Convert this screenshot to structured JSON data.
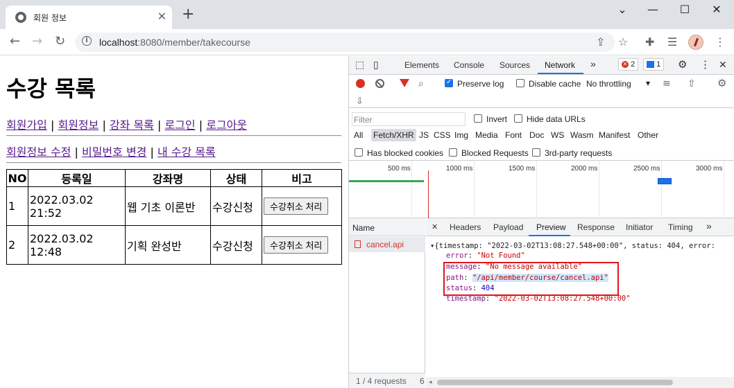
{
  "browser": {
    "tab_title": "회원 정보",
    "url_host": "localhost",
    "url_path": ":8080/member/takecourse",
    "new_tab_symbol": "+",
    "tab_close_symbol": "✕",
    "window_controls": {
      "minimize": "—",
      "maximize": "☐",
      "close": "✕"
    },
    "dropdown_symbol": "⌄",
    "icons": [
      "back-arrow-icon",
      "forward-arrow-icon",
      "reload-icon",
      "site-info-icon",
      "share-icon",
      "bookmark-star-icon",
      "extensions-icon",
      "reading-list-icon",
      "profile-avatar-icon",
      "browser-menu-icon"
    ]
  },
  "page": {
    "heading": "수강 목록",
    "nav1": [
      "회원가입",
      "회원정보",
      "강좌 목록",
      "로그인",
      "로그아웃"
    ],
    "nav2": [
      "회원정보 수정",
      "비밀번호 변경",
      "내 수강 목록"
    ],
    "separator": "|",
    "table": {
      "headers": [
        "NO",
        "등록일",
        "강좌명",
        "상태",
        "비고"
      ],
      "rows": [
        {
          "no": "1",
          "date": "2022.03.02 21:52",
          "course": "웹 기초 이론반",
          "status": "수강신청",
          "action": "수강취소 처리"
        },
        {
          "no": "2",
          "date": "2022.03.02 12:48",
          "course": "기획 완성반",
          "status": "수강신청",
          "action": "수강취소 처리"
        }
      ]
    }
  },
  "devtools": {
    "tabs": [
      "Elements",
      "Console",
      "Sources",
      "Network"
    ],
    "active_tab": "Network",
    "more_tabs": "»",
    "error_count": "2",
    "message_count": "1",
    "preserve_log": "Preserve log",
    "disable_cache": "Disable cache",
    "throttling": "No throttling",
    "filter_placeholder": "Filter",
    "invert": "Invert",
    "hide_data_urls": "Hide data URLs",
    "type_filters": [
      "All",
      "Fetch/XHR",
      "JS",
      "CSS",
      "Img",
      "Media",
      "Font",
      "Doc",
      "WS",
      "Wasm",
      "Manifest",
      "Other"
    ],
    "active_type": "Fetch/XHR",
    "has_blocked_cookies": "Has blocked cookies",
    "blocked_requests": "Blocked Requests",
    "third_party": "3rd-party requests",
    "timeline_ticks": [
      "500 ms",
      "1000 ms",
      "1500 ms",
      "2000 ms",
      "2500 ms",
      "3000 ms"
    ],
    "name_header": "Name",
    "request_name": "cancel.api",
    "status_bar": "1 / 4 requests",
    "status_bar_cut": "6",
    "sub_tabs": [
      "Headers",
      "Payload",
      "Preview",
      "Response",
      "Initiator",
      "Timing"
    ],
    "active_sub_tab": "Preview",
    "sub_close": "✕",
    "preview": {
      "summary": "▾{timestamp: \"2022-03-02T13:08:27.548+00:00\", status: 404, error:",
      "error_key": "error",
      "error_val": "\"Not Found\"",
      "message_key": "message",
      "message_val": "\"No message available\"",
      "path_key": "path",
      "path_val": "\"/api/member/course/cancel.api\"",
      "status_key": "status",
      "status_val": "404",
      "timestamp_key": "timestamp",
      "timestamp_val": "\"2022-03-02T13:08:27.548+00:00\""
    },
    "colors": {
      "accent": "#1a73e8",
      "error": "#d93025",
      "highlight_box": "#e0141c"
    }
  }
}
